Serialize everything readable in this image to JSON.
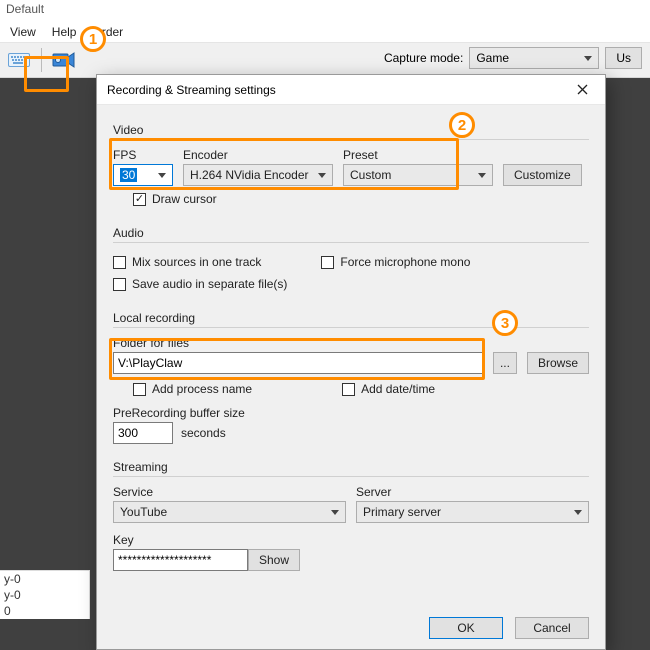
{
  "window": {
    "title": "Default"
  },
  "menu": {
    "view": "View",
    "help": "Help",
    "order": "Order"
  },
  "toolbar": {
    "capture_mode_label": "Capture mode:",
    "capture_mode_value": "Game",
    "us_btn": "Us"
  },
  "left_list": {
    "a": "y-0",
    "b": "y-0",
    "c": "0"
  },
  "dialog": {
    "title": "Recording & Streaming settings",
    "video": {
      "section": "Video",
      "fps_label": "FPS",
      "fps_value": "30",
      "encoder_label": "Encoder",
      "encoder_value": "H.264 NVidia Encoder",
      "preset_label": "Preset",
      "preset_value": "Custom",
      "customize": "Customize",
      "draw_cursor": "Draw cursor"
    },
    "audio": {
      "section": "Audio",
      "mix": "Mix sources in one track",
      "force_mono": "Force microphone mono",
      "save_sep": "Save audio in separate file(s)"
    },
    "local": {
      "section": "Local recording",
      "folder_label": "Folder for files",
      "folder_value": "V:\\PlayClaw",
      "browse_ellipsis": "...",
      "browse": "Browse",
      "add_process": "Add process name",
      "add_date": "Add date/time",
      "prerec_label": "PreRecording buffer size",
      "prerec_value": "300",
      "seconds": "seconds"
    },
    "stream": {
      "section": "Streaming",
      "service_label": "Service",
      "service_value": "YouTube",
      "server_label": "Server",
      "server_value": "Primary server",
      "key_label": "Key",
      "key_value": "********************",
      "show": "Show"
    },
    "ok": "OK",
    "cancel": "Cancel"
  },
  "callouts": {
    "one": "1",
    "two": "2",
    "three": "3"
  }
}
